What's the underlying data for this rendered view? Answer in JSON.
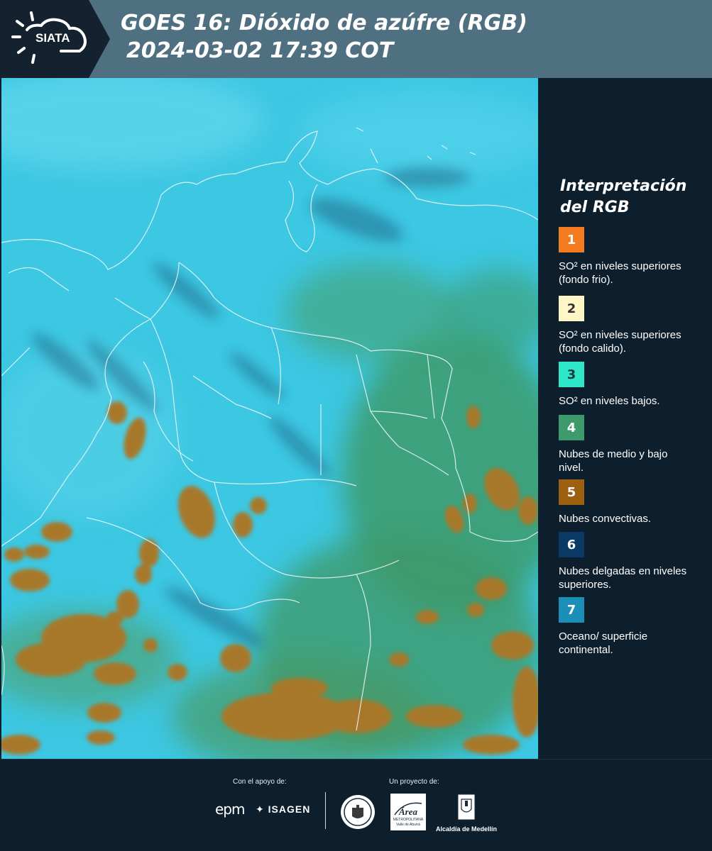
{
  "header": {
    "logo_text": "SIATA",
    "title_line1": "GOES 16: Dióxido de azúfre (RGB)",
    "title_line2": "2024-03-02 17:39 COT"
  },
  "legend": {
    "title": "Interpretación del RGB",
    "items": [
      {
        "number": "1",
        "color": "#f47b20",
        "text_color": "#ffffff",
        "label": "SO² en niveles superiores (fondo frio)."
      },
      {
        "number": "2",
        "color": "#fff6c6",
        "text_color": "#333333",
        "label": "SO² en niveles superiores (fondo calido)."
      },
      {
        "number": "3",
        "color": "#2ee6c8",
        "text_color": "#1a3a3a",
        "label": "SO² en niveles bajos."
      },
      {
        "number": "4",
        "color": "#3d9b6b",
        "text_color": "#ffffff",
        "label": "Nubes de medio y bajo nivel."
      },
      {
        "number": "5",
        "color": "#9c6010",
        "text_color": "#ffffff",
        "label": "Nubes convectivas."
      },
      {
        "number": "6",
        "color": "#0c3a66",
        "text_color": "#ffffff",
        "label": "Nubes delgadas en niveles superiores."
      },
      {
        "number": "7",
        "color": "#1b8fb8",
        "text_color": "#ffffff",
        "label": "Oceano/ superficie continental."
      }
    ]
  },
  "footer": {
    "support_label": "Con el apoyo de:",
    "project_label": "Un proyecto de:",
    "sponsor_epm": "epm",
    "sponsor_isagen": "ISAGEN",
    "area_logo_text": "Área",
    "area_logo_subtext": "METROPOLITANA",
    "area_logo_subtext2": "Valle de Aburrá",
    "alcaldia_label": "Alcaldía de Medellín"
  },
  "colors": {
    "header_bg": "#4f7080",
    "page_bg": "#0d1f2d",
    "ocean_cyan": "#3cc7e2",
    "convective_brown": "#a8782a",
    "mid_cloud_green": "#3d9b6b"
  }
}
